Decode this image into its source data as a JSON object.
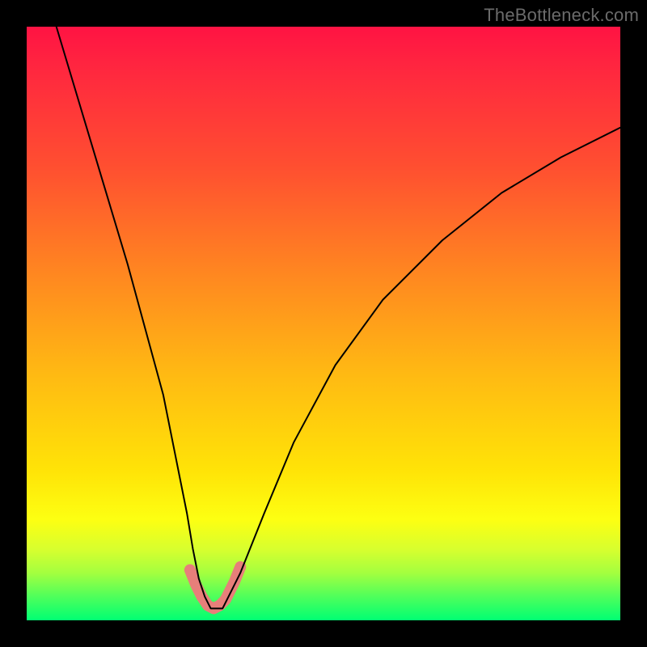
{
  "watermark": "TheBottleneck.com",
  "chart_data": {
    "type": "line",
    "title": "",
    "xlabel": "",
    "ylabel": "",
    "xlim": [
      0,
      100
    ],
    "ylim": [
      0,
      100
    ],
    "series": [
      {
        "name": "main-curve",
        "x": [
          5,
          8,
          11,
          14,
          17,
          20,
          23,
          25,
          27,
          28,
          29,
          30,
          31,
          32,
          33,
          34,
          36,
          40,
          45,
          52,
          60,
          70,
          80,
          90,
          100
        ],
        "y": [
          100,
          90,
          80,
          70,
          60,
          49,
          38,
          28,
          18,
          12,
          7,
          4,
          2,
          2,
          2,
          4,
          8,
          18,
          30,
          43,
          54,
          64,
          72,
          78,
          83
        ]
      },
      {
        "name": "highlight-segment",
        "x": [
          27.5,
          28.5,
          29.5,
          30.5,
          31.5,
          32.5,
          33.5,
          35.0,
          36.0
        ],
        "y": [
          8.5,
          6.0,
          4.0,
          2.5,
          2.0,
          2.5,
          3.5,
          6.5,
          9.0
        ]
      }
    ],
    "styles": {
      "main_curve_color": "#000000",
      "main_curve_width": 2,
      "highlight_color": "#e77f7a",
      "highlight_width": 14
    },
    "gradient_stops": [
      {
        "pos": 0.0,
        "color": "#ff1343"
      },
      {
        "pos": 0.06,
        "color": "#ff2440"
      },
      {
        "pos": 0.24,
        "color": "#ff5030"
      },
      {
        "pos": 0.42,
        "color": "#ff8820"
      },
      {
        "pos": 0.58,
        "color": "#ffb813"
      },
      {
        "pos": 0.75,
        "color": "#ffe407"
      },
      {
        "pos": 0.83,
        "color": "#fdff12"
      },
      {
        "pos": 0.88,
        "color": "#d8ff2e"
      },
      {
        "pos": 0.92,
        "color": "#a4ff3f"
      },
      {
        "pos": 0.96,
        "color": "#4fff5b"
      },
      {
        "pos": 1.0,
        "color": "#00ff73"
      }
    ]
  }
}
